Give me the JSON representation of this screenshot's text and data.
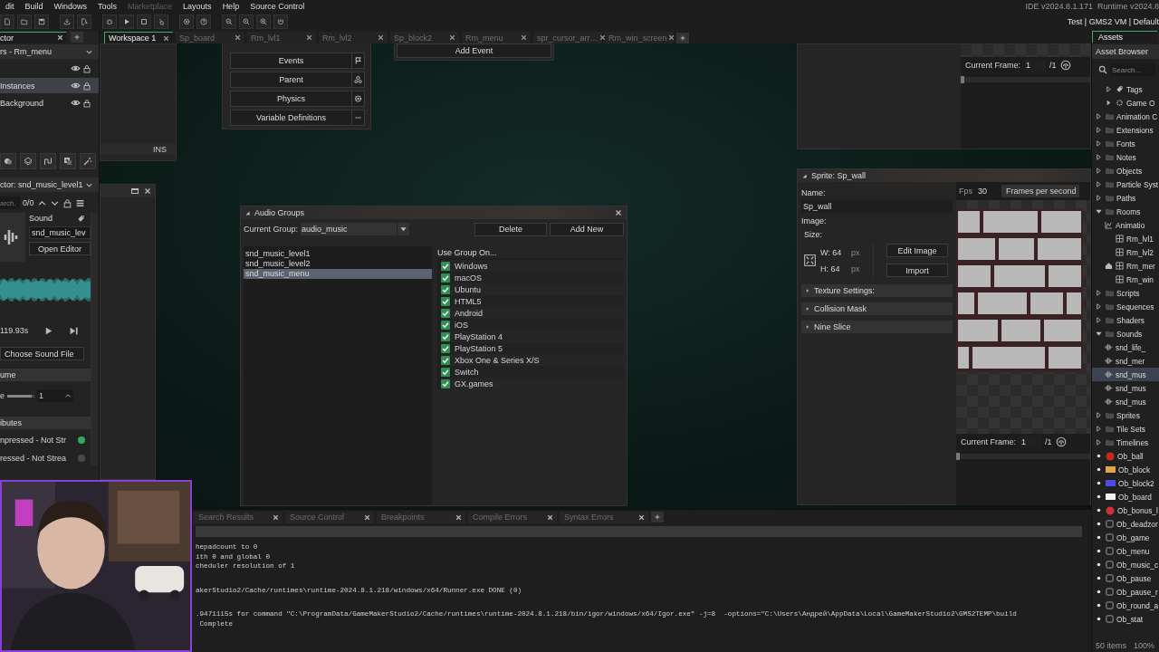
{
  "menu_bar": {
    "items": [
      {
        "label": "dit",
        "disabled": false
      },
      {
        "label": "Build",
        "disabled": false
      },
      {
        "label": "Windows",
        "disabled": false
      },
      {
        "label": "Tools",
        "disabled": false
      },
      {
        "label": "Marketplace",
        "disabled": true
      },
      {
        "label": "Layouts",
        "disabled": false
      },
      {
        "label": "Help",
        "disabled": false
      },
      {
        "label": "Source Control",
        "disabled": false
      }
    ],
    "ide_version": "IDE v2024.8.1.171",
    "runtime_version": "Runtime v2024.8"
  },
  "toolbar": {
    "target": "Test | GMS2 VM | Default"
  },
  "left_dock": {
    "tab": "ctor",
    "layers": {
      "title": "rs - Rm_menu",
      "items": [
        {
          "name": "Instances",
          "selected": true
        },
        {
          "name": "Background",
          "selected": false
        }
      ]
    },
    "inspector": {
      "title": "ctor: snd_music_level1",
      "search_placeholder": "arch.",
      "match_count": "0/0",
      "type_label": "Sound",
      "name_value": "snd_music_lev",
      "open_editor": "Open Editor",
      "duration": "119.93s",
      "choose_file": "Choose Sound File",
      "volume_section": "ume",
      "volume_label": "e",
      "volume": {
        "level": 0.9,
        "value": "1"
      },
      "attributes_section": "ibutes",
      "attributes": [
        {
          "label": "npressed - Not Str",
          "on": true
        },
        {
          "label": "ressed - Not Strea",
          "on": false
        }
      ]
    }
  },
  "workspace": {
    "tabs": [
      {
        "label": "Workspace 1",
        "selected": true
      },
      {
        "label": "Sp_board",
        "selected": false
      },
      {
        "label": "Rm_lvl1",
        "selected": false
      },
      {
        "label": "Rm_lvl2",
        "selected": false
      },
      {
        "label": "Sp_block2",
        "selected": false
      },
      {
        "label": "Rm_menu",
        "selected": false
      },
      {
        "label": "spr_cursor_arr…",
        "selected": false
      },
      {
        "label": "Rm_win_screen",
        "selected": false
      }
    ],
    "code_window": {
      "status": "INS"
    },
    "object_editor": {
      "buttons": [
        {
          "label": "Events",
          "kind": "flag"
        },
        {
          "label": "Parent",
          "kind": "parent"
        },
        {
          "label": "Physics",
          "kind": "gear"
        },
        {
          "label": "Variable Definitions",
          "kind": "more"
        }
      ]
    },
    "events_panel": {
      "button": "Add Event"
    },
    "preview_window": {
      "frame_label": "Current Frame:",
      "frame_value": "1",
      "frame_total": "/1",
      "frame_slider": {
        "level": 0
      }
    },
    "audio_groups": {
      "title": "Audio Groups",
      "group_label": "Current Group:",
      "group_value": "audio_music",
      "delete": "Delete",
      "add_new": "Add New",
      "sounds": [
        {
          "name": "snd_music_level1",
          "selected": false
        },
        {
          "name": "snd_music_level2",
          "selected": false
        },
        {
          "name": "snd_music_menu",
          "selected": true
        }
      ],
      "platforms_label": "Use Group On...",
      "platforms": [
        {
          "name": "Windows",
          "checked": true
        },
        {
          "name": "macOS",
          "checked": true
        },
        {
          "name": "Ubuntu",
          "checked": true
        },
        {
          "name": "HTML5",
          "checked": true
        },
        {
          "name": "Android",
          "checked": true
        },
        {
          "name": "iOS",
          "checked": true
        },
        {
          "name": "PlayStation 4",
          "checked": true
        },
        {
          "name": "PlayStation 5",
          "checked": true
        },
        {
          "name": "Xbox One & Series X/S",
          "checked": true
        },
        {
          "name": "Switch",
          "checked": true
        },
        {
          "name": "GX.games",
          "checked": true
        }
      ]
    },
    "sprite_editor": {
      "title": "Sprite: Sp_wall",
      "name_label": "Name:",
      "name_value": "Sp_wall",
      "image_label": "Image:",
      "size_label": "Size:",
      "width": "W: 64",
      "height": "H: 64",
      "unit_w": "px",
      "unit_h": "px",
      "edit_image": "Edit Image",
      "import": "Import",
      "sections": [
        {
          "label": "Texture Settings:",
          "expanded": false
        },
        {
          "label": "Collision Mask",
          "expanded": false
        },
        {
          "label": "Nine Slice",
          "expanded": false
        }
      ],
      "fps_label": "Fps",
      "fps_value": "30",
      "fps_mode": "Frames per second",
      "frame_label": "Current Frame:",
      "frame_value": "1",
      "frame_total": "/1",
      "frame_slider": {
        "level": 0
      }
    }
  },
  "asset_browser": {
    "tab": "Assets",
    "title": "Asset Browser",
    "search_placeholder": "Search...",
    "items": [
      {
        "label": "Tags",
        "kind": "tag",
        "expanded": false,
        "selected": false
      },
      {
        "label": "Game O",
        "kind": "options",
        "expanded": false,
        "selected": false
      },
      {
        "label": "Animation C",
        "kind": "folder",
        "expanded": false,
        "selected": false
      },
      {
        "label": "Extensions",
        "kind": "folder",
        "expanded": false,
        "selected": false
      },
      {
        "label": "Fonts",
        "kind": "folder",
        "expanded": false,
        "selected": false
      },
      {
        "label": "Notes",
        "kind": "folder",
        "expanded": false,
        "selected": false
      },
      {
        "label": "Objects",
        "kind": "folder",
        "expanded": false,
        "selected": false
      },
      {
        "label": "Particle Syst",
        "kind": "folder",
        "expanded": false,
        "selected": false
      },
      {
        "label": "Paths",
        "kind": "folder",
        "expanded": false,
        "selected": false
      },
      {
        "label": "Rooms",
        "kind": "folder",
        "expanded": true,
        "selected": false,
        "children": [
          {
            "label": "Animatio",
            "kind": "sequence",
            "selected": false
          },
          {
            "label": "Rm_lvl1",
            "kind": "room",
            "home": false,
            "selected": false
          },
          {
            "label": "Rm_lvl2",
            "kind": "room",
            "home": false,
            "selected": false
          },
          {
            "label": "Rm_mer",
            "kind": "room",
            "home": true,
            "selected": false
          },
          {
            "label": "Rm_win",
            "kind": "room",
            "home": false,
            "selected": false
          }
        ]
      },
      {
        "label": "Scripts",
        "kind": "folder",
        "expanded": false,
        "selected": false
      },
      {
        "label": "Sequences",
        "kind": "folder",
        "expanded": false,
        "selected": false
      },
      {
        "label": "Shaders",
        "kind": "folder",
        "expanded": false,
        "selected": false
      },
      {
        "label": "Sounds",
        "kind": "folder",
        "expanded": true,
        "selected": false,
        "children": [
          {
            "label": "snd_life_",
            "kind": "sound",
            "selected": false
          },
          {
            "label": "snd_mer",
            "kind": "sound",
            "selected": false
          },
          {
            "label": "snd_mus",
            "kind": "sound",
            "selected": true
          },
          {
            "label": "snd_mus",
            "kind": "sound",
            "selected": false
          },
          {
            "label": "snd_mus",
            "kind": "sound",
            "selected": false
          }
        ]
      },
      {
        "label": "Sprites",
        "kind": "folder",
        "expanded": false,
        "selected": false
      },
      {
        "label": "Tile Sets",
        "kind": "folder",
        "expanded": false,
        "selected": false
      },
      {
        "label": "Timelines",
        "kind": "folder",
        "expanded": false,
        "selected": false
      },
      {
        "label": "Ob_ball",
        "kind": "ball",
        "color": "#c42a22",
        "selected": false
      },
      {
        "label": "Ob_block",
        "kind": "bar",
        "color": "#e3a44a",
        "selected": false
      },
      {
        "label": "Ob_block2",
        "kind": "bar",
        "color": "#4b4be6",
        "selected": false
      },
      {
        "label": "Ob_board",
        "kind": "bar",
        "color": "#f2f2f2",
        "selected": false
      },
      {
        "label": "Ob_bonus_l",
        "kind": "ball",
        "color": "#d0303a",
        "selected": false
      },
      {
        "label": "Ob_deadzor",
        "kind": "object",
        "selected": false
      },
      {
        "label": "Ob_game",
        "kind": "object",
        "selected": false
      },
      {
        "label": "Ob_menu",
        "kind": "object",
        "selected": false
      },
      {
        "label": "Ob_music_c",
        "kind": "object",
        "selected": false
      },
      {
        "label": "Ob_pause",
        "kind": "object",
        "selected": false
      },
      {
        "label": "Ob_pause_r",
        "kind": "object",
        "selected": false
      },
      {
        "label": "Ob_round_a",
        "kind": "object",
        "selected": false
      },
      {
        "label": "Ob_stat",
        "kind": "object",
        "selected": false
      }
    ],
    "item_count": "50 items",
    "zoom": "100%"
  },
  "output": {
    "tabs": [
      {
        "label": "Search Results",
        "selected": false
      },
      {
        "label": "Source Control",
        "selected": false
      },
      {
        "label": "Breakpoints",
        "selected": false
      },
      {
        "label": "Compile Errors",
        "selected": false
      },
      {
        "label": "Syntax Errors",
        "selected": false
      }
    ],
    "blocks": [
      [
        "hepadcount to 0",
        "ith 0 and global 0",
        "cheduler resolution of 1"
      ],
      [
        "akerStudio2/Cache/runtimes\\runtime-2024.8.1.218/windows/x64/Runner.exe DONE (0)"
      ],
      [
        ".9471115s for command \"C:\\ProgramData/GameMakerStudio2/Cache/runtimes\\runtime-2024.8.1.218/bin/igor/windows/x64/Igor.exe\" -j=8  -options=\"C:\\Users\\Андрей\\AppData\\Local\\GameMakerStudio2\\GMS2TEMP\\build",
        " Complete"
      ]
    ]
  }
}
